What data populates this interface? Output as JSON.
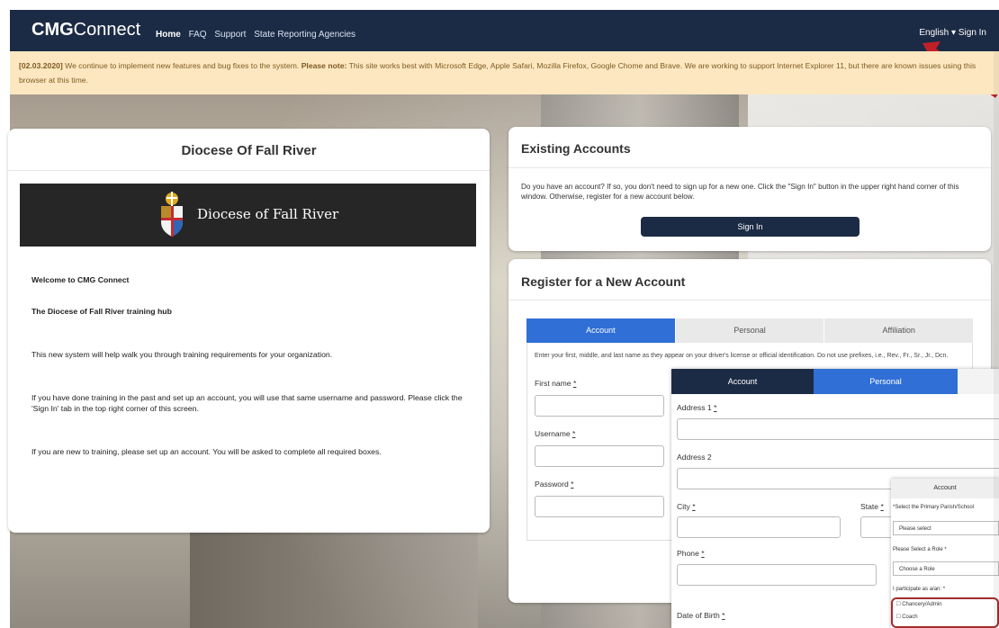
{
  "nav": {
    "brand_bold": "CMG",
    "brand_rest": "Connect",
    "links": [
      "Home",
      "FAQ",
      "Support",
      "State Reporting Agencies"
    ],
    "language": "English ▾",
    "sign_in": "Sign In"
  },
  "alert": {
    "date": "[02.03.2020]",
    "text_1": " We continue to implement new features and bug fixes to the system. ",
    "note_label": "Please note:",
    "text_2": " This site works best with Microsoft Edge, Apple Safari, Mozilla Firefox, Google Chome and Brave. We are working to support Internet Explorer 11, but there are known issues using this browser at this time."
  },
  "left_card": {
    "title": "Diocese Of Fall River",
    "logo_text": "Diocese of Fall River",
    "p1": "Welcome to CMG Connect",
    "p2": "The Diocese of Fall River training hub",
    "p3": "This new system will help walk you through training requirements for your organization.",
    "p4": "If you have done training in the past and set up an account, you will use that same username and password. Please click the 'Sign In' tab in the top right corner of this screen.",
    "p5": "If you are new to training, please set up an account.  You will be asked to complete all required boxes."
  },
  "existing": {
    "title": "Existing Accounts",
    "text": "Do you have an account? If so, you don't need to sign up for a new one. Click the \"Sign In\" button in the upper right hand corner of this window. Otherwise, register for a new account below.",
    "button": "Sign In"
  },
  "register": {
    "title": "Register for a New Account",
    "tabs": [
      "Account",
      "Personal",
      "Affiliation"
    ],
    "note": "Enter your first, middle, and last name as they appear on your driver's license or official identification. Do not use prefixes, i.e., Rev., Fr., Sr., Jr., Dcn.",
    "first_name": "First name",
    "username": "Username",
    "password": "Password",
    "required": "*"
  },
  "overlay1": {
    "tabs": [
      "Account",
      "Personal"
    ],
    "address1": "Address 1",
    "address2": "Address 2",
    "city": "City",
    "state": "State",
    "phone": "Phone",
    "dob": "Date of Birth",
    "required": "*"
  },
  "overlay2": {
    "tab": "Account",
    "select_prompt": "*Select the Primary Parish/School",
    "please_select": "Please select",
    "role_prompt": "Please Select a Role *",
    "choose_role": "Choose a Role",
    "participate": "I participate as a/an: *",
    "options": [
      "Chancery/Admin",
      "Coach"
    ]
  },
  "colors": {
    "nav": "#1c2b45",
    "active_tab": "#2f6fd6",
    "alert_bg": "#fde7c1",
    "arrow": "#c0202a"
  }
}
